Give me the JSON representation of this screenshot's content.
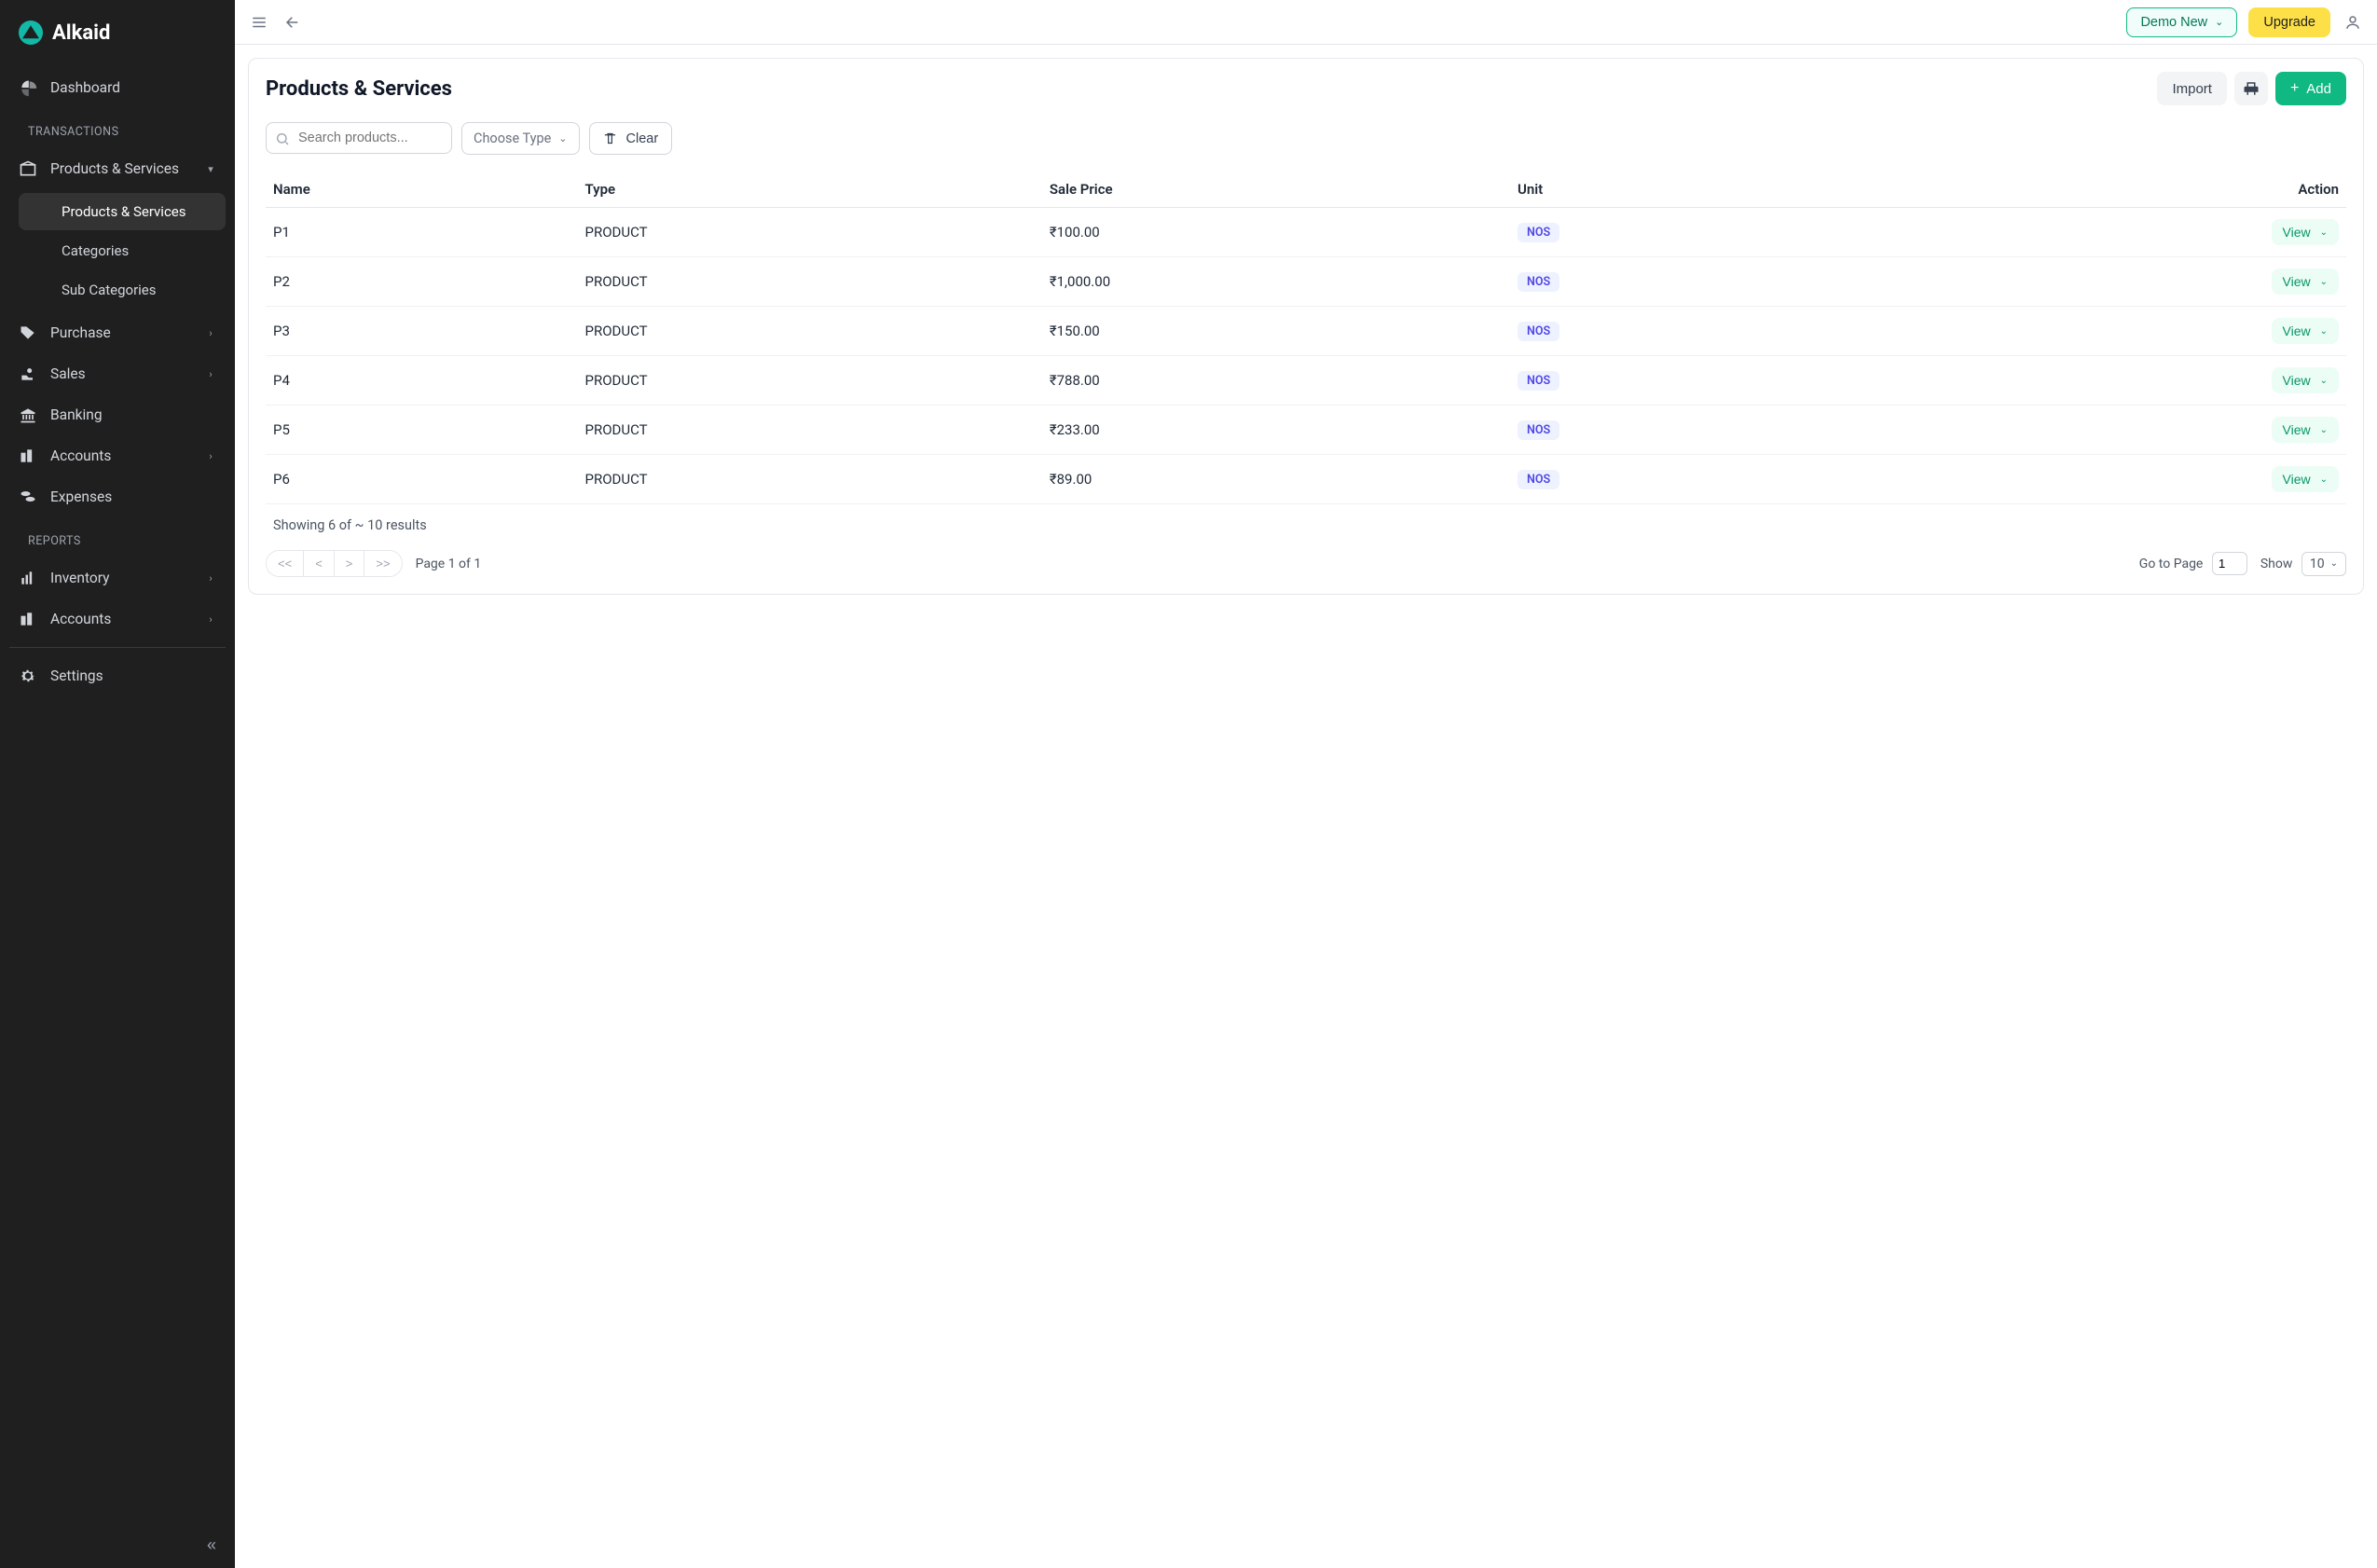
{
  "brand": {
    "name": "Alkaid"
  },
  "sidebar": {
    "dashboard": "Dashboard",
    "section_transactions": "TRANSACTIONS",
    "products_services": "Products & Services",
    "sub_products_services": "Products & Services",
    "sub_categories": "Categories",
    "sub_sub_categories": "Sub Categories",
    "purchase": "Purchase",
    "sales": "Sales",
    "banking": "Banking",
    "accounts": "Accounts",
    "expenses": "Expenses",
    "section_reports": "REPORTS",
    "inventory": "Inventory",
    "accounts2": "Accounts",
    "settings": "Settings"
  },
  "topbar": {
    "company": "Demo New",
    "upgrade": "Upgrade"
  },
  "page": {
    "title": "Products & Services",
    "import": "Import",
    "add": "Add",
    "search_placeholder": "Search products...",
    "choose_type": "Choose Type",
    "clear": "Clear"
  },
  "table": {
    "headers": {
      "name": "Name",
      "type": "Type",
      "sale_price": "Sale Price",
      "unit": "Unit",
      "action": "Action"
    },
    "view_label": "View",
    "rows": [
      {
        "name": "P1",
        "type": "PRODUCT",
        "sale_price": "₹100.00",
        "unit": "NOS"
      },
      {
        "name": "P2",
        "type": "PRODUCT",
        "sale_price": "₹1,000.00",
        "unit": "NOS"
      },
      {
        "name": "P3",
        "type": "PRODUCT",
        "sale_price": "₹150.00",
        "unit": "NOS"
      },
      {
        "name": "P4",
        "type": "PRODUCT",
        "sale_price": "₹788.00",
        "unit": "NOS"
      },
      {
        "name": "P5",
        "type": "PRODUCT",
        "sale_price": "₹233.00",
        "unit": "NOS"
      },
      {
        "name": "P6",
        "type": "PRODUCT",
        "sale_price": "₹89.00",
        "unit": "NOS"
      }
    ],
    "results_text": "Showing 6 of ~ 10 results"
  },
  "pagination": {
    "first": "<<",
    "prev": "<",
    "next": ">",
    "last": ">>",
    "page_text": "Page 1 of 1",
    "goto_label": "Go to Page",
    "goto_value": "1",
    "show_label": "Show",
    "show_value": "10"
  }
}
